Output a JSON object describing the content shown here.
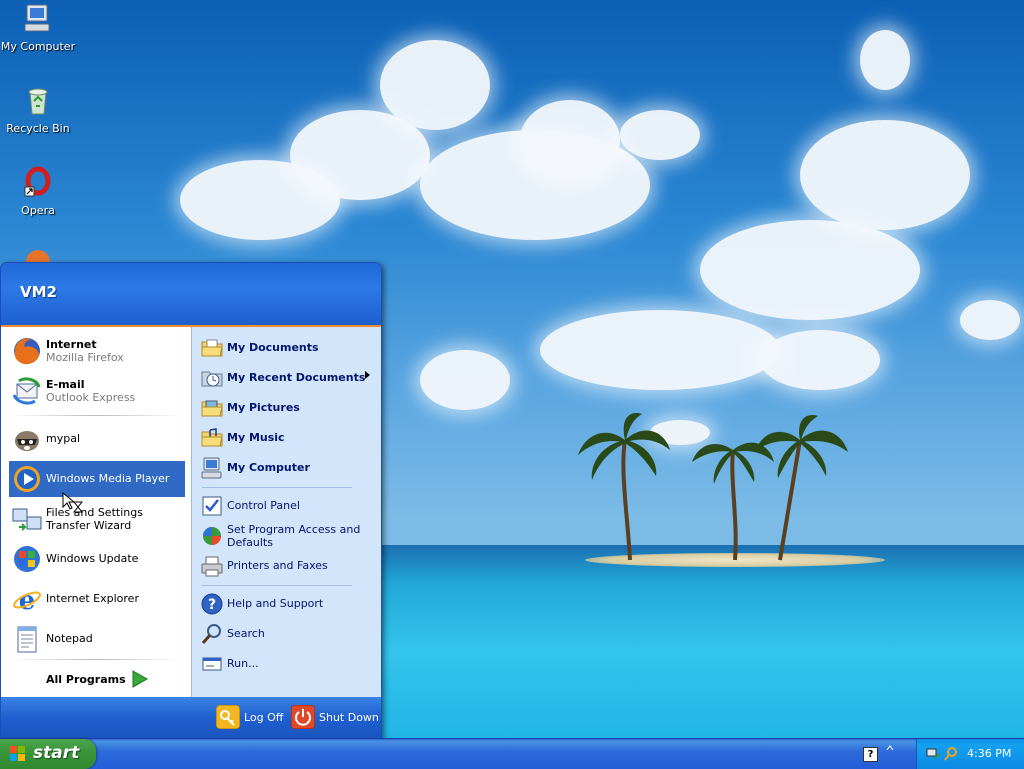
{
  "desktop": {
    "icons": [
      {
        "label": "My Computer",
        "icon": "my-computer-icon"
      },
      {
        "label": "Recycle Bin",
        "icon": "recycle-bin-icon"
      },
      {
        "label": "Opera",
        "icon": "opera-icon"
      }
    ]
  },
  "start_menu": {
    "user": "VM2",
    "pinned": [
      {
        "title": "Internet",
        "subtitle": "Mozilla Firefox",
        "icon": "firefox-icon"
      },
      {
        "title": "E-mail",
        "subtitle": "Outlook Express",
        "icon": "outlook-express-icon"
      }
    ],
    "recent": [
      {
        "label": "mypal",
        "icon": "mypal-icon"
      },
      {
        "label": "Windows Media Player",
        "icon": "windows-media-player-icon",
        "selected": true
      },
      {
        "label": "Files and Settings Transfer Wizard",
        "icon": "transfer-wizard-icon"
      },
      {
        "label": "Windows Update",
        "icon": "windows-update-icon"
      },
      {
        "label": "Internet Explorer",
        "icon": "internet-explorer-icon"
      },
      {
        "label": "Notepad",
        "icon": "notepad-icon"
      }
    ],
    "all_programs": "All Programs",
    "places": [
      {
        "label": "My Documents",
        "icon": "folder-icon"
      },
      {
        "label": "My Recent Documents",
        "icon": "recent-documents-icon",
        "submenu": true
      },
      {
        "label": "My Pictures",
        "icon": "pictures-folder-icon"
      },
      {
        "label": "My Music",
        "icon": "music-folder-icon"
      },
      {
        "label": "My Computer",
        "icon": "my-computer-icon"
      }
    ],
    "settings": [
      {
        "label": "Control Panel",
        "icon": "control-panel-icon"
      },
      {
        "label": "Set Program Access and Defaults",
        "icon": "program-access-icon"
      },
      {
        "label": "Printers and Faxes",
        "icon": "printer-icon"
      }
    ],
    "help": [
      {
        "label": "Help and Support",
        "icon": "help-icon"
      },
      {
        "label": "Search",
        "icon": "search-icon"
      },
      {
        "label": "Run...",
        "icon": "run-icon"
      }
    ],
    "footer": {
      "log_off": "Log Off",
      "shut_down": "Shut Down"
    }
  },
  "taskbar": {
    "start_label": "start",
    "clock": "4:36 PM"
  }
}
